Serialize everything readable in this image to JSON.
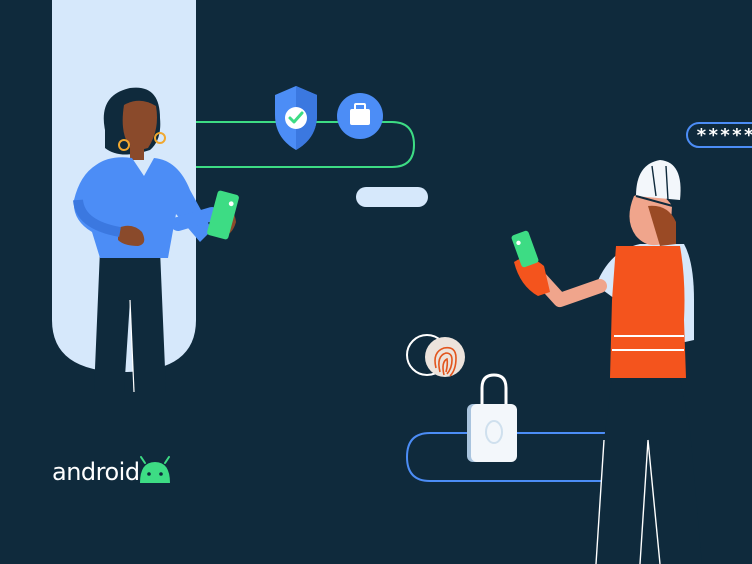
{
  "brand": {
    "wordmark": "android",
    "logo_icon": "android-bot-head-icon"
  },
  "password_field": {
    "masked_value": "*****"
  },
  "icons": [
    "shield-check-icon",
    "briefcase-icon",
    "padlock-icon",
    "fingerprint-icon",
    "face-circle-icon",
    "smartphone-icon"
  ],
  "colors": {
    "background": "#0f2a3c",
    "panel": "#d6e8fb",
    "android_green": "#3ddc84",
    "accent_blue": "#4c8df6",
    "vest_orange": "#f4541d",
    "line_green": "#3ddc84"
  }
}
